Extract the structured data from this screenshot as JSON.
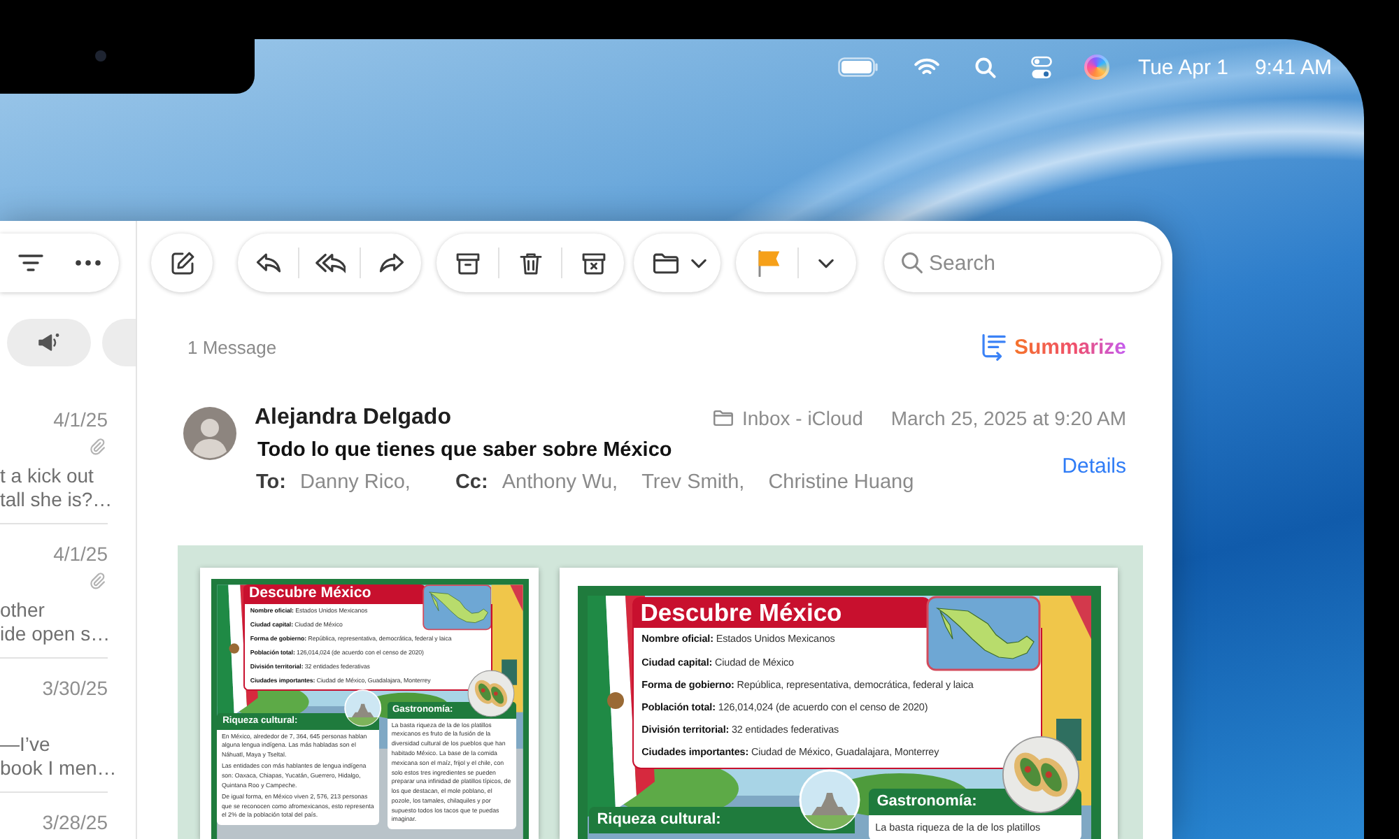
{
  "menu_bar": {
    "date": "Tue Apr 1",
    "time": "9:41 AM"
  },
  "toolbar": {
    "search": {
      "placeholder": "Search"
    }
  },
  "message_list": {
    "items": [
      {
        "date": "4/1/25",
        "attachment": true,
        "preview_lines": [
          "t a kick out",
          "tall she is?…"
        ]
      },
      {
        "date": "4/1/25",
        "attachment": true,
        "preview_lines": [
          "other",
          "ide open s…"
        ]
      },
      {
        "date": "3/30/25",
        "attachment": false,
        "preview_lines": [
          "—I’ve",
          "book I men…"
        ]
      },
      {
        "date": "3/28/25"
      }
    ]
  },
  "message": {
    "count": "1 Message",
    "summarize": "Summarize",
    "sender": "Alejandra Delgado",
    "mailbox": "Inbox - iCloud",
    "date": "March 25, 2025 at 9:20 AM",
    "subject": "Todo lo que tienes que saber sobre México",
    "details": "Details",
    "to_label": "To:",
    "to": [
      "Danny Rico,"
    ],
    "cc_label": "Cc:",
    "cc": [
      "Anthony Wu,",
      "Trev Smith,",
      "Christine Huang"
    ]
  },
  "attachment": {
    "pages": [
      {
        "title": "Descubre México",
        "facts": [
          "**Nombre oficial:** Estados Unidos Mexicanos",
          "**Ciudad capital:** Ciudad de México",
          "**Forma de gobierno:** República, representativa, democrática, federal y laica",
          "**Población total:** 126,014,024 (de acuerdo con el censo de 2020)",
          "**División territorial:** 32 entidades federativas",
          "**Ciudades importantes:** Ciudad de México, Guadalajara, Monterrey"
        ],
        "sections": [
          {
            "heading": "Riqueza cultural:",
            "paragraphs": [
              "En México, alrededor de 7, 364, 645 personas hablan alguna lengua indígena. Las más habladas son el Náhuatl, Maya y Tseltal.",
              "Las entidades con más hablantes de lengua indígena son: Oaxaca, Chiapas, Yucatán, Guerrero, Hidalgo, Quintana Roo y Campeche.",
              "De igual forma, en México viven 2, 576, 213 personas que se reconocen como afromexicanos, esto representa el 2% de la población total del país."
            ]
          },
          {
            "heading": "Gastronomía:",
            "paragraphs": [
              "La basta riqueza de la de los platillos mexicanos es fruto de la fusión de la diversidad cultural de los pueblos que han habitado México. La base de la comida mexicana son el maíz, frijol y el chile, con solo estos tres ingredientes se pueden preparar una infinidad de platillos típicos, de los que destacan, el mole poblano, el pozole, los tamales, chilaquiles y por supuesto todos los tacos que te puedas imaginar."
            ]
          }
        ]
      },
      {
        "title": "Descubre México",
        "facts": [
          "**Nombre oficial:** Estados Unidos Mexicanos",
          "**Ciudad capital:** Ciudad de México",
          "**Forma de gobierno:** República, representativa, democrática, federal y laica",
          "**Población total:** 126,014,024 (de acuerdo con el censo de 2020)",
          "**División territorial:** 32 entidades federativas",
          "**Ciudades importantes:** Ciudad de México, Guadalajara, Monterrey"
        ],
        "sections": [
          {
            "heading": "Riqueza cultural:"
          },
          {
            "heading": "Gastronomía:",
            "paragraphs": [
              "La basta riqueza de la de los platillos"
            ]
          }
        ]
      }
    ]
  }
}
